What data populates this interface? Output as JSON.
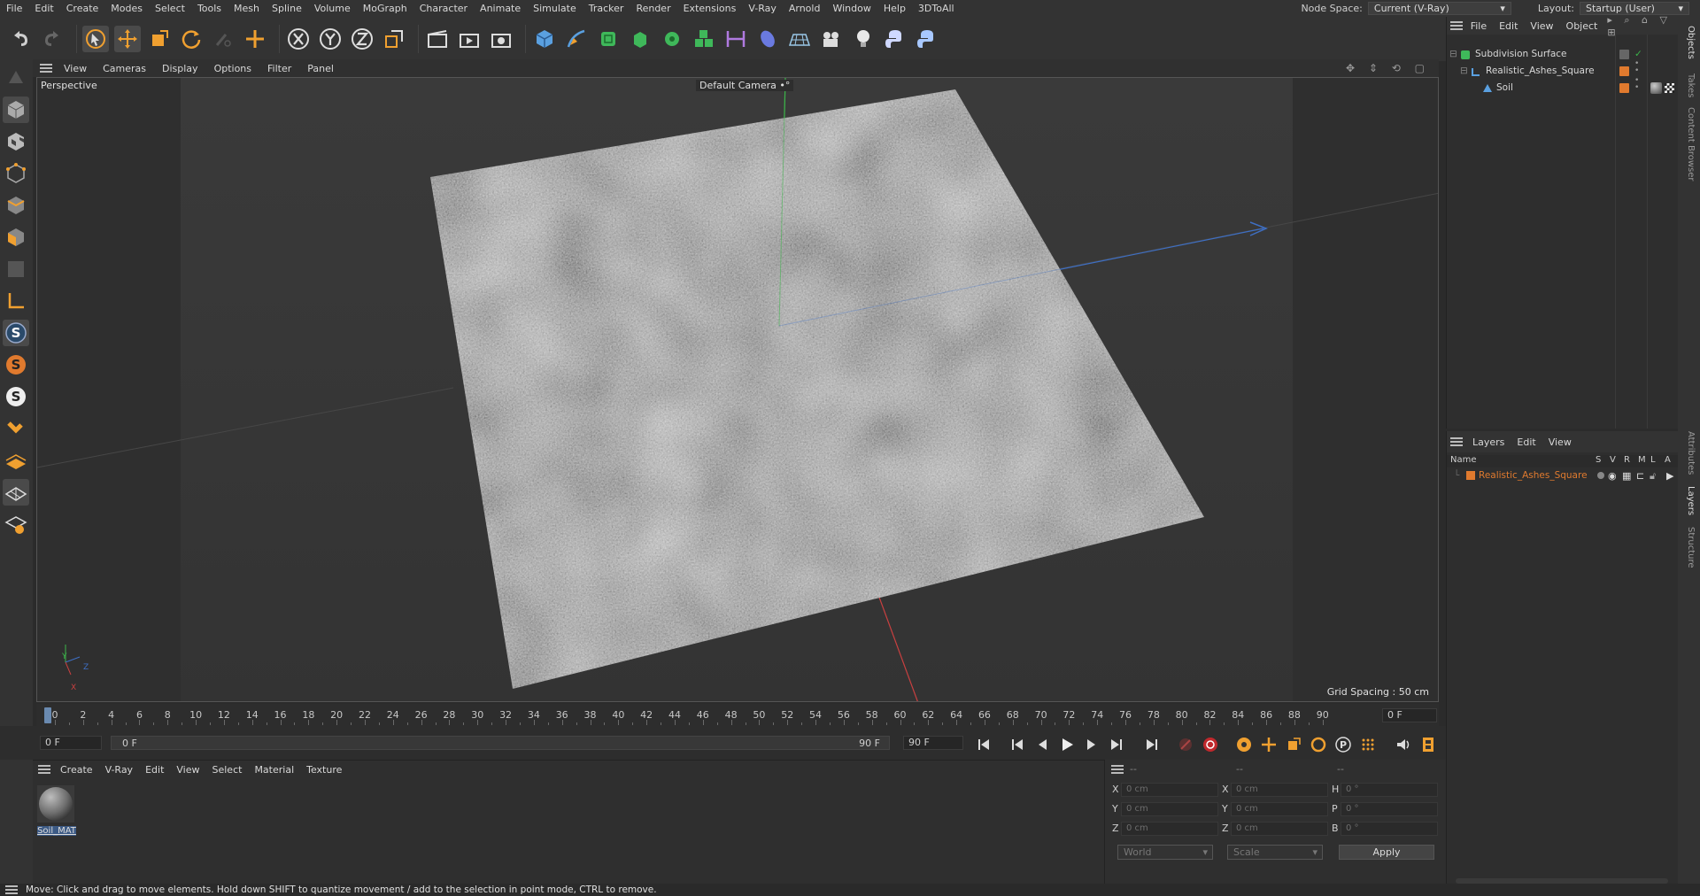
{
  "menubar": {
    "items": [
      "File",
      "Edit",
      "Create",
      "Modes",
      "Select",
      "Tools",
      "Mesh",
      "Spline",
      "Volume",
      "MoGraph",
      "Character",
      "Animate",
      "Simulate",
      "Tracker",
      "Render",
      "Extensions",
      "V-Ray",
      "Arnold",
      "Window",
      "Help",
      "3DToAll"
    ],
    "node_space_label": "Node Space:",
    "node_space_value": "Current (V-Ray)",
    "layout_label": "Layout:",
    "layout_value": "Startup (User)"
  },
  "viewport": {
    "menu": [
      "View",
      "Cameras",
      "Display",
      "Options",
      "Filter",
      "Panel"
    ],
    "view_name": "Perspective",
    "camera_name": "Default Camera",
    "camera_suffix": "•°",
    "grid_spacing": "Grid Spacing : 50 cm",
    "axis_labels": {
      "y": "Y",
      "z": "Z",
      "x": "X"
    }
  },
  "timeline": {
    "ticks": [
      "0",
      "2",
      "4",
      "6",
      "8",
      "10",
      "12",
      "14",
      "16",
      "18",
      "20",
      "22",
      "24",
      "26",
      "28",
      "30",
      "32",
      "34",
      "36",
      "38",
      "40",
      "42",
      "44",
      "46",
      "48",
      "50",
      "52",
      "54",
      "56",
      "58",
      "60",
      "62",
      "64",
      "66",
      "68",
      "70",
      "72",
      "74",
      "76",
      "78",
      "80",
      "82",
      "84",
      "86",
      "88",
      "90"
    ],
    "current_frame_right": "0 F",
    "start_field": "0 F",
    "range_start": "0 F",
    "range_end": "90 F",
    "end_field": "90 F"
  },
  "material_manager": {
    "menu": [
      "Create",
      "V-Ray",
      "Edit",
      "View",
      "Select",
      "Material",
      "Texture"
    ],
    "materials": [
      {
        "name": "Soil_MAT"
      }
    ]
  },
  "coordinates": {
    "header": [
      "--",
      "--",
      "--"
    ],
    "rows": [
      {
        "label": "X",
        "pos": "0 cm",
        "label2": "X",
        "size": "0 cm",
        "label3": "H",
        "rot": "0 °"
      },
      {
        "label": "Y",
        "pos": "0 cm",
        "label2": "Y",
        "size": "0 cm",
        "label3": "P",
        "rot": "0 °"
      },
      {
        "label": "Z",
        "pos": "0 cm",
        "label2": "Z",
        "size": "0 cm",
        "label3": "B",
        "rot": "0 °"
      }
    ],
    "mode": "World",
    "scale": "Scale",
    "apply": "Apply"
  },
  "object_manager": {
    "menu": [
      "File",
      "Edit",
      "View",
      "Object"
    ],
    "objects": [
      {
        "name": "Subdivision Surface",
        "depth": 0
      },
      {
        "name": "Realistic_Ashes_Square",
        "depth": 1
      },
      {
        "name": "Soil",
        "depth": 2
      }
    ]
  },
  "layers": {
    "menu": [
      "Layers",
      "Edit",
      "View"
    ],
    "columns": {
      "name": "Name",
      "s": "S",
      "v": "V",
      "r": "R",
      "m": "M",
      "l": "L",
      "a": "A"
    },
    "items": [
      {
        "name": "Realistic_Ashes_Square",
        "color": "#e07a2e"
      }
    ]
  },
  "right_tabs": [
    "Objects",
    "Takes",
    "Content Browser",
    "Attributes",
    "Layers",
    "Structure"
  ],
  "status": "Move: Click and drag to move elements. Hold down SHIFT to quantize movement / add to the selection in point mode, CTRL to remove.",
  "colors": {
    "accent_orange": "#e07a2e",
    "axis_x": "#c84040",
    "axis_y": "#3cb54a",
    "axis_z": "#3e6fc4"
  }
}
